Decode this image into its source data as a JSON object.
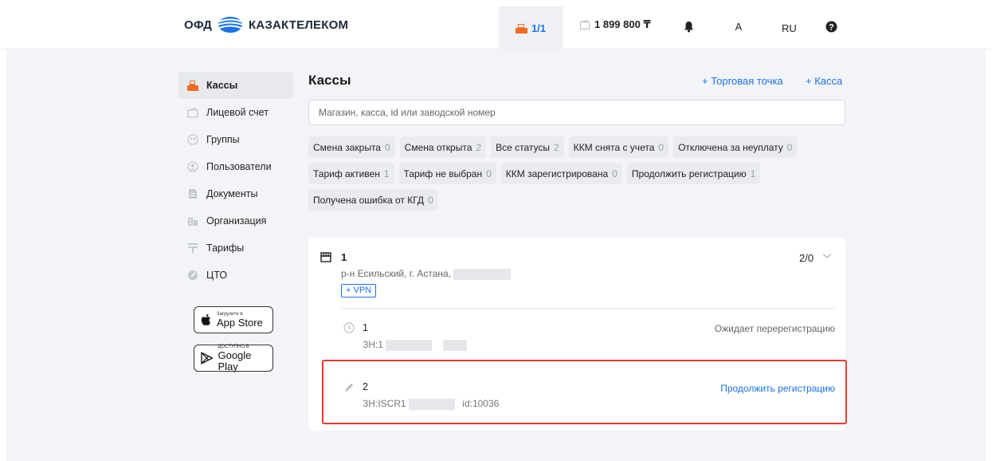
{
  "header": {
    "logo_text": "ОФД",
    "brand_text": "КАЗАКТЕЛЕКОМ",
    "cash_counter": "1/1",
    "balance": "1 899 800 ₸",
    "avatar_letter": "A",
    "language": "RU"
  },
  "sidebar": {
    "items": [
      {
        "label": "Кассы",
        "icon": "cashbox-icon"
      },
      {
        "label": "Лицевой счет",
        "icon": "wallet-icon"
      },
      {
        "label": "Группы",
        "icon": "groups-icon"
      },
      {
        "label": "Пользователи",
        "icon": "user-icon"
      },
      {
        "label": "Документы",
        "icon": "document-icon"
      },
      {
        "label": "Организация",
        "icon": "building-icon"
      },
      {
        "label": "Тарифы",
        "icon": "tariff-icon"
      },
      {
        "label": "ЦТО",
        "icon": "service-icon"
      }
    ],
    "app_store_small": "Загрузите в",
    "app_store_big": "App Store",
    "google_play_small": "ДОСТУПНО В",
    "google_play_big": "Google Play"
  },
  "main": {
    "title": "Кассы",
    "add_store_link": "+ Торговая точка",
    "add_cash_link": "+ Касса",
    "search_placeholder": "Магазин, касса, id или заводской номер",
    "filters": [
      {
        "label": "Смена закрыта",
        "count": "0"
      },
      {
        "label": "Смена открыта",
        "count": "2"
      },
      {
        "label": "Все статусы",
        "count": "2"
      },
      {
        "label": "ККМ снята с учета",
        "count": "0"
      },
      {
        "label": "Отключена за неуплату",
        "count": "0"
      },
      {
        "label": "Тариф активен",
        "count": "1"
      },
      {
        "label": "Тариф не выбран",
        "count": "0"
      },
      {
        "label": "ККМ зарегистрирована",
        "count": "0"
      },
      {
        "label": "Продолжить регистрацию",
        "count": "1"
      },
      {
        "label": "Получена ошибка от КГД",
        "count": "0"
      }
    ],
    "store": {
      "name": "1",
      "address": "р-н Есильский, г. Астана,",
      "counts": "2/0",
      "vpn_button": "+ VPN",
      "registers": [
        {
          "name": "1",
          "serial": "ЗН:1",
          "id_text": "",
          "status": "Ожидает перерегистрацию",
          "status_color": "#666666"
        },
        {
          "name": "2",
          "serial": "ЗН:ISCR1",
          "id_text": "id:10036",
          "status": "Продолжить регистрацию",
          "status_color": "#1a73e8"
        }
      ]
    }
  },
  "colors": {
    "accent": "#1a73e8",
    "brand_orange": "#f26b21",
    "highlight": "#e53935"
  }
}
